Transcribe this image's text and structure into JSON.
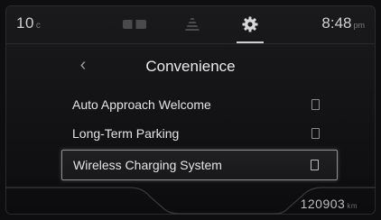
{
  "status_bar": {
    "temperature": "10",
    "temperature_unit": "c",
    "time": "8:48",
    "time_suffix": "pm"
  },
  "tabs": [
    {
      "icon": "road-icon"
    },
    {
      "icon": "lines-icon"
    },
    {
      "icon": "gear-icon",
      "active": true
    }
  ],
  "header": {
    "back_glyph": "‹",
    "title": "Convenience"
  },
  "menu": {
    "items": [
      {
        "label": "Auto Approach Welcome",
        "checked": false
      },
      {
        "label": "Long-Term Parking",
        "checked": false
      },
      {
        "label": "Wireless Charging System",
        "checked": false,
        "selected": true
      }
    ]
  },
  "odometer": {
    "value": "120903",
    "unit": "km"
  },
  "colors": {
    "background": "#0e0e10",
    "text": "#eaeaea",
    "dim_text": "#9a9a9a",
    "selection_border": "#8f8f8f"
  }
}
